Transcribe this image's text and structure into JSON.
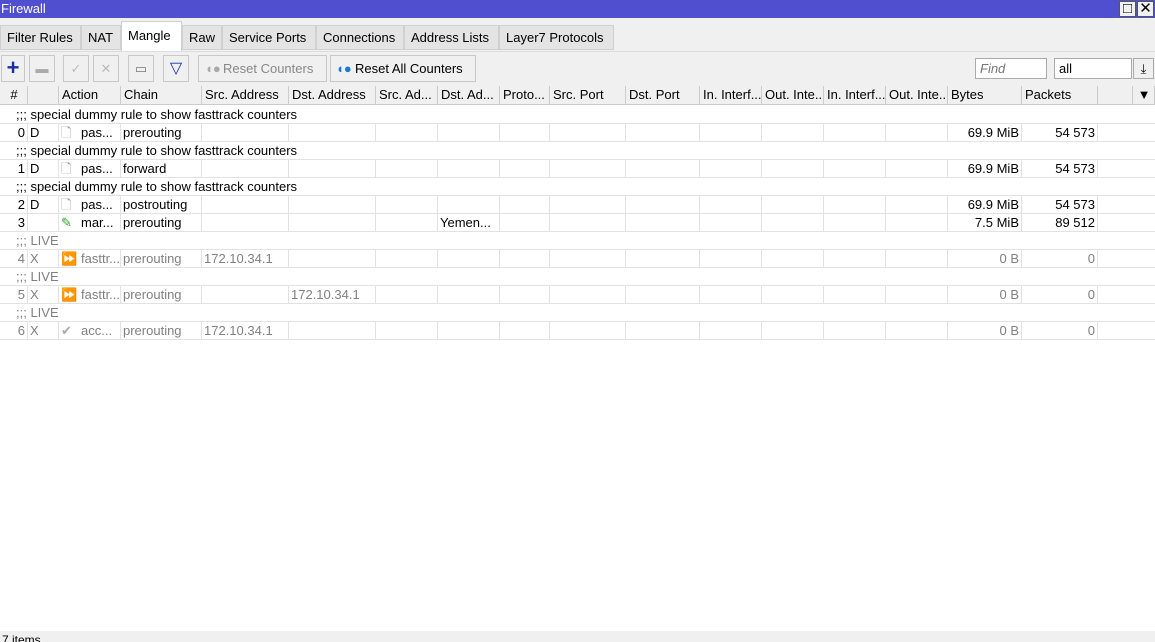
{
  "window": {
    "title": "Firewall",
    "maximize": "□",
    "close": "✕"
  },
  "tabs": [
    "Filter Rules",
    "NAT",
    "Mangle",
    "Raw",
    "Service Ports",
    "Connections",
    "Address Lists",
    "Layer7 Protocols"
  ],
  "active_tab": "Mangle",
  "toolbar": {
    "reset_counters": "Reset Counters",
    "reset_all_counters": "Reset All Counters",
    "find_placeholder": "Find",
    "filter_value": "all"
  },
  "columns": [
    "#",
    "",
    "Action",
    "Chain",
    "Src. Address",
    "Dst. Address",
    "Src. Ad...",
    "Dst. Ad...",
    "Proto...",
    "Src. Port",
    "Dst. Port",
    "In. Interf...",
    "Out. Inte...",
    "In. Interf...",
    "Out. Inte...",
    "Bytes",
    "Packets",
    ""
  ],
  "rows": [
    {
      "comment": ";;; special dummy rule to show fasttrack counters"
    },
    {
      "num": "0",
      "flag": "D",
      "icon": "passthrough-icon",
      "action": "pas...",
      "chain": "prerouting",
      "src": "",
      "dst": "",
      "dstad": "",
      "bytes": "69.9 MiB",
      "packets": "54 573"
    },
    {
      "comment": ";;; special dummy rule to show fasttrack counters"
    },
    {
      "num": "1",
      "flag": "D",
      "icon": "passthrough-icon",
      "action": "pas...",
      "chain": "forward",
      "src": "",
      "dst": "",
      "dstad": "",
      "bytes": "69.9 MiB",
      "packets": "54 573"
    },
    {
      "comment": ";;; special dummy rule to show fasttrack counters"
    },
    {
      "num": "2",
      "flag": "D",
      "icon": "passthrough-icon",
      "action": "pas...",
      "chain": "postrouting",
      "src": "",
      "dst": "",
      "dstad": "",
      "bytes": "69.9 MiB",
      "packets": "54 573"
    },
    {
      "num": "3",
      "flag": "",
      "icon": "mark-pencil-icon",
      "action": "mar...",
      "chain": "prerouting",
      "src": "",
      "dst": "",
      "dstad": "Yemen...",
      "bytes": "7.5 MiB",
      "packets": "89 512"
    },
    {
      "comment": ";;; LIVE",
      "disabled": true
    },
    {
      "num": "4",
      "flag": "X",
      "icon": "fasttrack-icon",
      "action": "fasttr...",
      "chain": "prerouting",
      "src": "172.10.34.1",
      "dst": "",
      "dstad": "",
      "bytes": "0 B",
      "packets": "0",
      "disabled": true
    },
    {
      "comment": ";;; LIVE",
      "disabled": true
    },
    {
      "num": "5",
      "flag": "X",
      "icon": "fasttrack-icon",
      "action": "fasttr...",
      "chain": "prerouting",
      "src": "",
      "dst": "172.10.34.1",
      "dstad": "",
      "bytes": "0 B",
      "packets": "0",
      "disabled": true
    },
    {
      "comment": ";;; LIVE",
      "disabled": true
    },
    {
      "num": "6",
      "flag": "X",
      "icon": "accept-icon",
      "action": "acc...",
      "chain": "prerouting",
      "src": "172.10.34.1",
      "dst": "",
      "dstad": "",
      "bytes": "0 B",
      "packets": "0",
      "disabled": true
    }
  ],
  "status": "7 items"
}
